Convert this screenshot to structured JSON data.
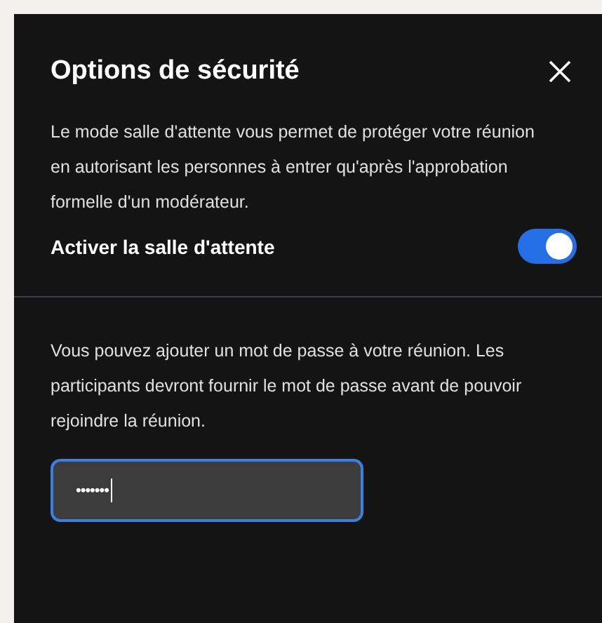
{
  "dialog": {
    "title": "Options de sécurité"
  },
  "lobby": {
    "description": "Le mode salle d'attente vous permet de protéger votre réunion en autorisant les personnes à entrer qu'après l'approbation formelle d'un modérateur.",
    "toggle_label": "Activer la salle d'attente",
    "on": true
  },
  "password": {
    "description": "Vous pouvez ajouter un mot de passe à votre réunion. Les participants devront fournir le mot de passe avant de pouvoir rejoindre la réunion.",
    "value": "•••••••",
    "focused": true
  }
}
